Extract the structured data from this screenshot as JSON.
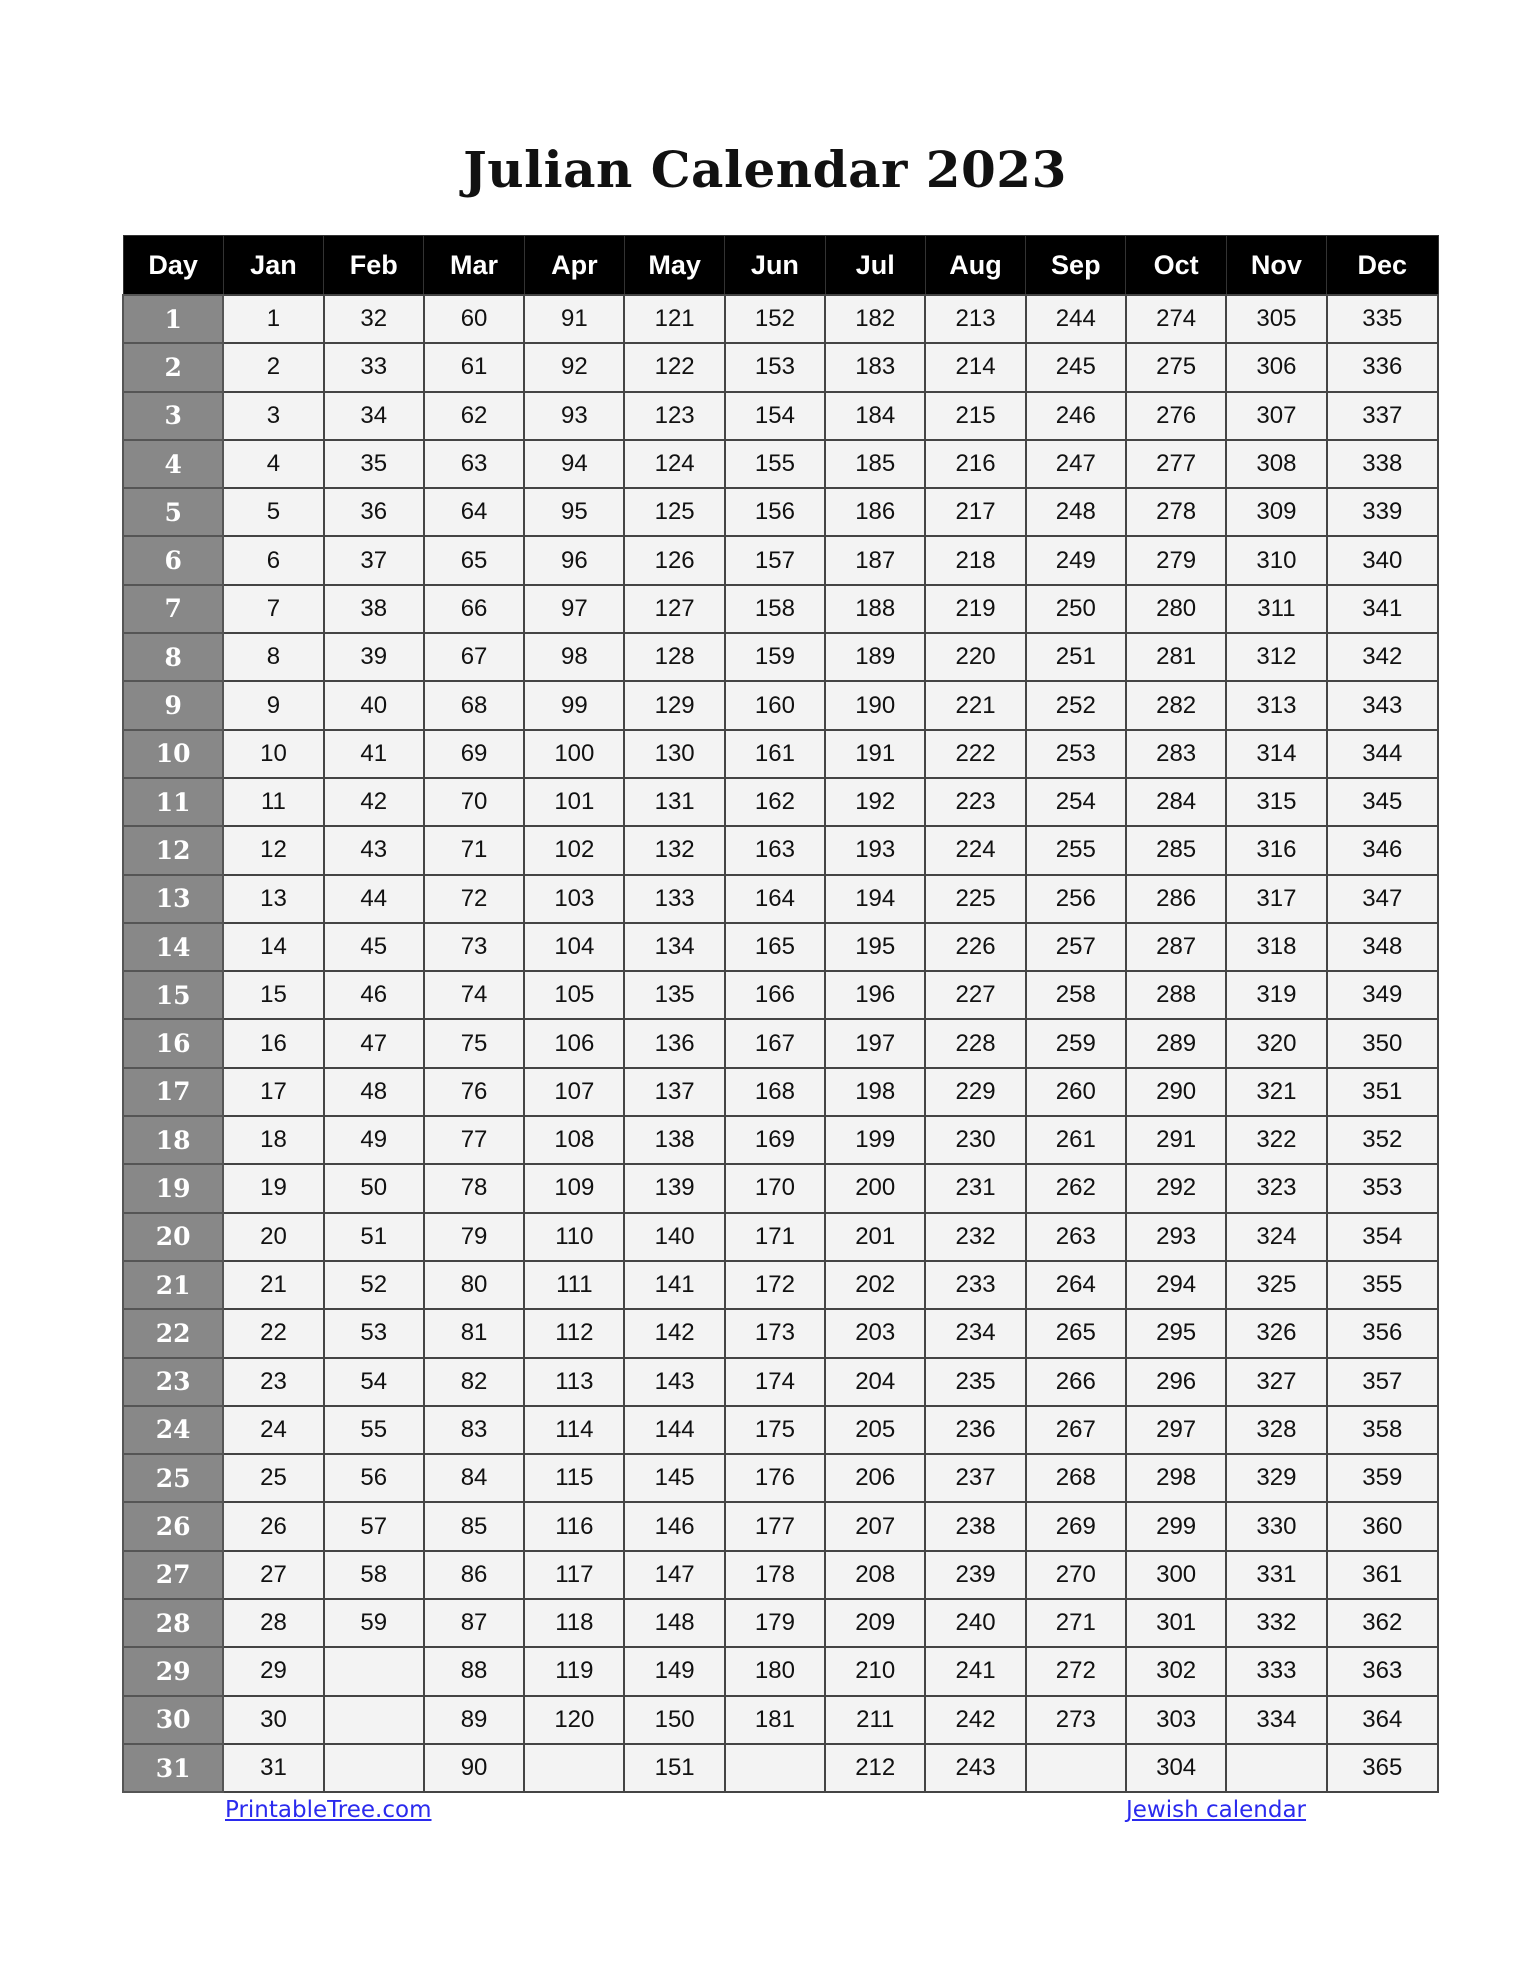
{
  "title": "Julian Calendar 2023",
  "table": {
    "header": [
      "Day",
      "Jan",
      "Feb",
      "Mar",
      "Apr",
      "May",
      "Jun",
      "Jul",
      "Aug",
      "Sep",
      "Oct",
      "Nov",
      "Dec"
    ],
    "month_lengths": [
      31,
      28,
      31,
      30,
      31,
      30,
      31,
      31,
      30,
      31,
      30,
      31
    ],
    "month_start_day_of_year": [
      1,
      32,
      60,
      91,
      121,
      152,
      182,
      213,
      244,
      274,
      305,
      335
    ],
    "rows": [
      {
        "day": "1",
        "values": [
          "1",
          "32",
          "60",
          "91",
          "121",
          "152",
          "182",
          "213",
          "244",
          "274",
          "305",
          "335"
        ]
      },
      {
        "day": "2",
        "values": [
          "2",
          "33",
          "61",
          "92",
          "122",
          "153",
          "183",
          "214",
          "245",
          "275",
          "306",
          "336"
        ]
      },
      {
        "day": "3",
        "values": [
          "3",
          "34",
          "62",
          "93",
          "123",
          "154",
          "184",
          "215",
          "246",
          "276",
          "307",
          "337"
        ]
      },
      {
        "day": "4",
        "values": [
          "4",
          "35",
          "63",
          "94",
          "124",
          "155",
          "185",
          "216",
          "247",
          "277",
          "308",
          "338"
        ]
      },
      {
        "day": "5",
        "values": [
          "5",
          "36",
          "64",
          "95",
          "125",
          "156",
          "186",
          "217",
          "248",
          "278",
          "309",
          "339"
        ]
      },
      {
        "day": "6",
        "values": [
          "6",
          "37",
          "65",
          "96",
          "126",
          "157",
          "187",
          "218",
          "249",
          "279",
          "310",
          "340"
        ]
      },
      {
        "day": "7",
        "values": [
          "7",
          "38",
          "66",
          "97",
          "127",
          "158",
          "188",
          "219",
          "250",
          "280",
          "311",
          "341"
        ]
      },
      {
        "day": "8",
        "values": [
          "8",
          "39",
          "67",
          "98",
          "128",
          "159",
          "189",
          "220",
          "251",
          "281",
          "312",
          "342"
        ]
      },
      {
        "day": "9",
        "values": [
          "9",
          "40",
          "68",
          "99",
          "129",
          "160",
          "190",
          "221",
          "252",
          "282",
          "313",
          "343"
        ]
      },
      {
        "day": "10",
        "values": [
          "10",
          "41",
          "69",
          "100",
          "130",
          "161",
          "191",
          "222",
          "253",
          "283",
          "314",
          "344"
        ]
      },
      {
        "day": "11",
        "values": [
          "11",
          "42",
          "70",
          "101",
          "131",
          "162",
          "192",
          "223",
          "254",
          "284",
          "315",
          "345"
        ]
      },
      {
        "day": "12",
        "values": [
          "12",
          "43",
          "71",
          "102",
          "132",
          "163",
          "193",
          "224",
          "255",
          "285",
          "316",
          "346"
        ]
      },
      {
        "day": "13",
        "values": [
          "13",
          "44",
          "72",
          "103",
          "133",
          "164",
          "194",
          "225",
          "256",
          "286",
          "317",
          "347"
        ]
      },
      {
        "day": "14",
        "values": [
          "14",
          "45",
          "73",
          "104",
          "134",
          "165",
          "195",
          "226",
          "257",
          "287",
          "318",
          "348"
        ]
      },
      {
        "day": "15",
        "values": [
          "15",
          "46",
          "74",
          "105",
          "135",
          "166",
          "196",
          "227",
          "258",
          "288",
          "319",
          "349"
        ]
      },
      {
        "day": "16",
        "values": [
          "16",
          "47",
          "75",
          "106",
          "136",
          "167",
          "197",
          "228",
          "259",
          "289",
          "320",
          "350"
        ]
      },
      {
        "day": "17",
        "values": [
          "17",
          "48",
          "76",
          "107",
          "137",
          "168",
          "198",
          "229",
          "260",
          "290",
          "321",
          "351"
        ]
      },
      {
        "day": "18",
        "values": [
          "18",
          "49",
          "77",
          "108",
          "138",
          "169",
          "199",
          "230",
          "261",
          "291",
          "322",
          "352"
        ]
      },
      {
        "day": "19",
        "values": [
          "19",
          "50",
          "78",
          "109",
          "139",
          "170",
          "200",
          "231",
          "262",
          "292",
          "323",
          "353"
        ]
      },
      {
        "day": "20",
        "values": [
          "20",
          "51",
          "79",
          "110",
          "140",
          "171",
          "201",
          "232",
          "263",
          "293",
          "324",
          "354"
        ]
      },
      {
        "day": "21",
        "values": [
          "21",
          "52",
          "80",
          "111",
          "141",
          "172",
          "202",
          "233",
          "264",
          "294",
          "325",
          "355"
        ]
      },
      {
        "day": "22",
        "values": [
          "22",
          "53",
          "81",
          "112",
          "142",
          "173",
          "203",
          "234",
          "265",
          "295",
          "326",
          "356"
        ]
      },
      {
        "day": "23",
        "values": [
          "23",
          "54",
          "82",
          "113",
          "143",
          "174",
          "204",
          "235",
          "266",
          "296",
          "327",
          "357"
        ]
      },
      {
        "day": "24",
        "values": [
          "24",
          "55",
          "83",
          "114",
          "144",
          "175",
          "205",
          "236",
          "267",
          "297",
          "328",
          "358"
        ]
      },
      {
        "day": "25",
        "values": [
          "25",
          "56",
          "84",
          "115",
          "145",
          "176",
          "206",
          "237",
          "268",
          "298",
          "329",
          "359"
        ]
      },
      {
        "day": "26",
        "values": [
          "26",
          "57",
          "85",
          "116",
          "146",
          "177",
          "207",
          "238",
          "269",
          "299",
          "330",
          "360"
        ]
      },
      {
        "day": "27",
        "values": [
          "27",
          "58",
          "86",
          "117",
          "147",
          "178",
          "208",
          "239",
          "270",
          "300",
          "331",
          "361"
        ]
      },
      {
        "day": "28",
        "values": [
          "28",
          "59",
          "87",
          "118",
          "148",
          "179",
          "209",
          "240",
          "271",
          "301",
          "332",
          "362"
        ]
      },
      {
        "day": "29",
        "values": [
          "29",
          "",
          "88",
          "119",
          "149",
          "180",
          "210",
          "241",
          "272",
          "302",
          "333",
          "363"
        ]
      },
      {
        "day": "30",
        "values": [
          "30",
          "",
          "89",
          "120",
          "150",
          "181",
          "211",
          "242",
          "273",
          "303",
          "334",
          "364"
        ]
      },
      {
        "day": "31",
        "values": [
          "31",
          "",
          "90",
          "",
          "151",
          "",
          "212",
          "243",
          "",
          "304",
          "",
          "365"
        ]
      }
    ]
  },
  "footer": {
    "left_link": "PrintableTree.com",
    "right_link": "Jewish calendar"
  },
  "colors": {
    "header_bg": "#000000",
    "day_column_bg": "#888888",
    "cell_bg": "#f3f3f3",
    "link": "#2a2aee"
  }
}
